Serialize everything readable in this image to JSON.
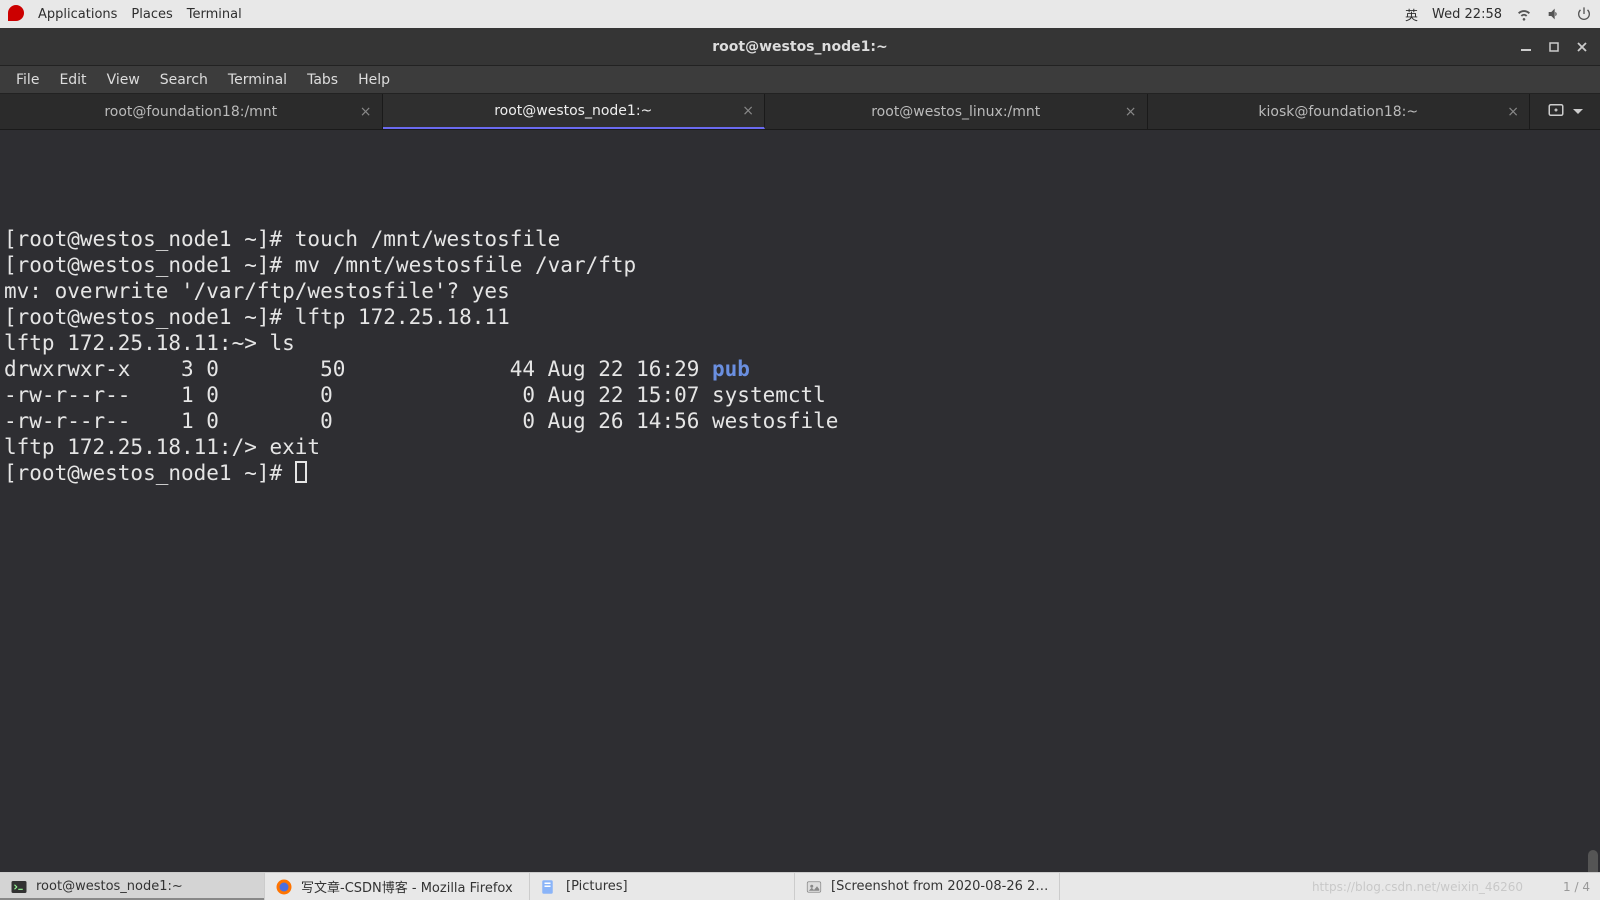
{
  "top_panel": {
    "applications": "Applications",
    "places": "Places",
    "terminal": "Terminal",
    "ime": "英",
    "clock": "Wed 22:58"
  },
  "window": {
    "title": "root@westos_node1:~"
  },
  "menu": {
    "file": "File",
    "edit": "Edit",
    "view": "View",
    "search": "Search",
    "terminal": "Terminal",
    "tabs": "Tabs",
    "help": "Help"
  },
  "tabs": [
    {
      "label": "root@foundation18:/mnt",
      "active": false
    },
    {
      "label": "root@westos_node1:~",
      "active": true
    },
    {
      "label": "root@westos_linux:/mnt",
      "active": false
    },
    {
      "label": "kiosk@foundation18:~",
      "active": false
    }
  ],
  "terminal": {
    "l1": "[root@westos_node1 ~]# touch /mnt/westosfile",
    "l2": "[root@westos_node1 ~]# mv /mnt/westosfile /var/ftp",
    "l3": "mv: overwrite '/var/ftp/westosfile'? yes",
    "l4": "[root@westos_node1 ~]# lftp 172.25.18.11",
    "l5": "lftp 172.25.18.11:~> ls",
    "l6a": "drwxrwxr-x    3 0        50             44 Aug 22 16:29 ",
    "l6b": "pub",
    "l7": "-rw-r--r--    1 0        0               0 Aug 22 15:07 systemctl",
    "l8": "-rw-r--r--    1 0        0               0 Aug 26 14:56 westosfile",
    "l9": "lftp 172.25.18.11:/> exit",
    "l10": "[root@westos_node1 ~]# "
  },
  "taskbar": {
    "t1": "root@westos_node1:~",
    "t2": "写文章-CSDN博客 - Mozilla Firefox",
    "t3": "[Pictures]",
    "t4": "[Screenshot from 2020-08-26 21-…",
    "watermark": "https://blog.csdn.net/weixin_46260",
    "page": "1 / 4"
  }
}
